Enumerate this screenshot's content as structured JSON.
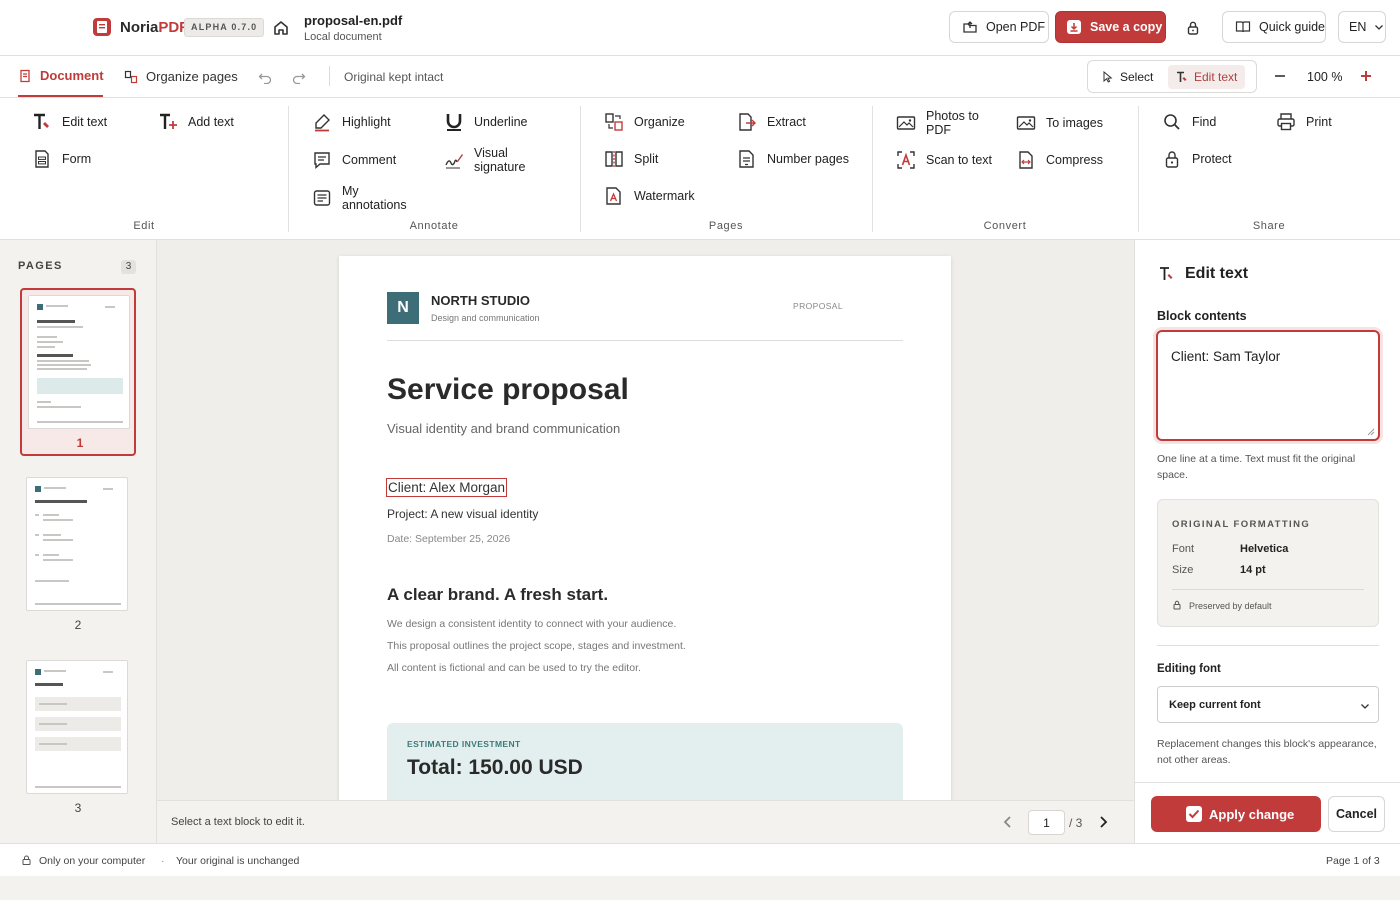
{
  "app": {
    "brand_prefix": "Noria",
    "brand_suffix": "PDF",
    "version_badge": "ALPHA 0.7.0",
    "accent_color": "#c23b3b"
  },
  "file": {
    "name": "proposal-en.pdf",
    "location": "Local document"
  },
  "header": {
    "open_label": "Open PDF",
    "save_label": "Save a copy",
    "guide_label": "Quick guide",
    "language": "EN"
  },
  "tabs": {
    "document": "Document",
    "organize": "Organize pages",
    "status_note": "Original kept intact"
  },
  "modes": {
    "select": "Select",
    "edit": "Edit text"
  },
  "zoom": "100 %",
  "ribbon": {
    "edit": {
      "label": "Edit",
      "tools": [
        "Edit text",
        "Add text",
        "Form"
      ]
    },
    "annotate": {
      "label": "Annotate",
      "tools": [
        "Highlight",
        "Underline",
        "Comment",
        "Visual signature",
        "My annotations"
      ]
    },
    "pages": {
      "label": "Pages",
      "tools": [
        "Organize",
        "Extract",
        "Split",
        "Number pages",
        "Watermark"
      ]
    },
    "convert": {
      "label": "Convert",
      "tools": [
        "Photos to PDF",
        "To images",
        "Scan to text",
        "Compress"
      ]
    },
    "share": {
      "label": "Share",
      "tools": [
        "Find",
        "Print",
        "Protect"
      ]
    }
  },
  "sidebar": {
    "title": "PAGES",
    "count": "3",
    "pages": [
      "1",
      "2",
      "3"
    ]
  },
  "document": {
    "logo_letter": "N",
    "studio": "NORTH STUDIO",
    "studio_sub": "Design and communication",
    "tag": "PROPOSAL",
    "title": "Service proposal",
    "subtitle": "Visual identity and brand communication",
    "client": "Client: Alex Morgan",
    "project": "Project: A new visual identity",
    "date": "Date: September 25, 2026",
    "heading2": "A clear brand. A fresh start.",
    "paragraph": [
      "We design a consistent identity to connect with your audience.",
      "This proposal outlines the project scope, stages and investment.",
      "All content is fictional and can be used to try the editor."
    ],
    "invest_label": "ESTIMATED INVESTMENT",
    "invest_total": "Total: 150.00 USD"
  },
  "footer": {
    "hint": "Select a text block to edit it.",
    "page_input": "1",
    "page_total": "/ 3"
  },
  "panel": {
    "title": "Edit text",
    "block_label": "Block contents",
    "block_value": "Client: Sam Taylor",
    "help": "One line at a time. Text must fit the original space.",
    "formatting_title": "ORIGINAL FORMATTING",
    "font_key": "Font",
    "font_value": "Helvetica",
    "size_key": "Size",
    "size_value": "14 pt",
    "preserved": "Preserved by default",
    "editing_font_label": "Editing font",
    "editing_font_value": "Keep current font",
    "editing_font_help": "Replacement changes this block's appearance, not other areas.",
    "apply_label": "Apply change",
    "cancel_label": "Cancel"
  },
  "status": {
    "local": "Only on your computer",
    "separator": "·",
    "original": "Your original is unchanged",
    "page": "Page 1 of 3"
  }
}
